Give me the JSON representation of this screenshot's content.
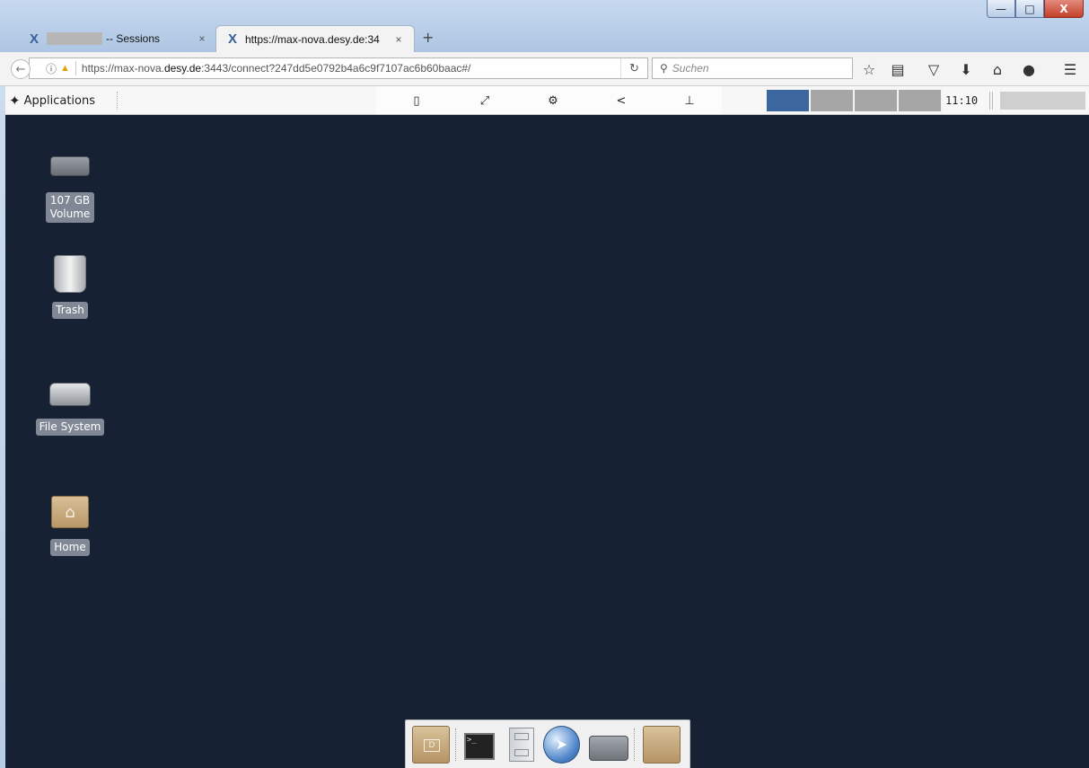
{
  "tabs": [
    {
      "title": "-- Sessions",
      "icon": "x2go-icon",
      "active": false
    },
    {
      "title": "https://max-nova.desy.de:34",
      "icon": "x2go-icon",
      "active": true
    }
  ],
  "tab_close_glyph": "×",
  "new_tab_glyph": "+",
  "window_controls": {
    "minimize": "—",
    "maximize": "□",
    "close": "X"
  },
  "navbar": {
    "url_prefix": "https://max-nova.",
    "url_domain": "desy.de",
    "url_suffix": ":3443/connect?247dd5e0792b4a6c9f7107ac6b60baac#/",
    "search_placeholder": "Suchen"
  },
  "panel": {
    "applications_label": "Applications",
    "clock": "11:10",
    "workspaces": [
      {
        "active": true
      },
      {
        "active": false
      },
      {
        "active": false
      },
      {
        "active": false
      }
    ]
  },
  "desktop_icons": [
    {
      "label": "107 GB Volume",
      "icon": "drive-icon"
    },
    {
      "label": "Trash",
      "icon": "trash-icon"
    },
    {
      "label": "File System",
      "icon": "filesystem-icon"
    },
    {
      "label": "Home",
      "icon": "home-folder-icon"
    }
  ],
  "dock_items": [
    {
      "name": "documents-folder-icon",
      "glyph": "D"
    },
    {
      "name": "terminal-icon",
      "glyph": ">_"
    },
    {
      "name": "file-cabinet-icon"
    },
    {
      "name": "web-browser-icon"
    },
    {
      "name": "drive-icon"
    },
    {
      "name": "folder-icon"
    }
  ]
}
